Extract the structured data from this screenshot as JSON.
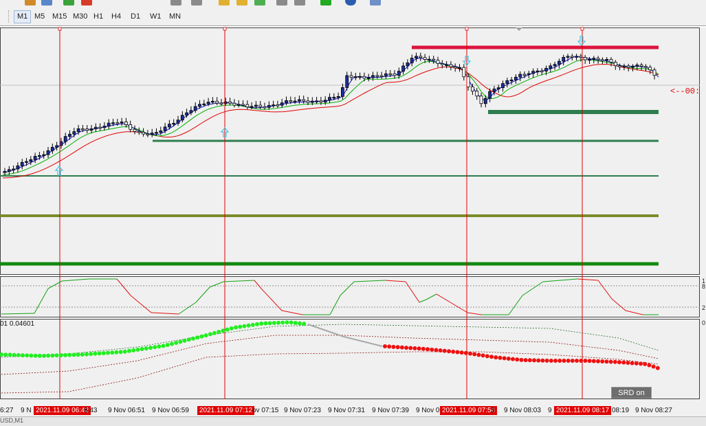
{
  "toolbar": {
    "timeframes": [
      {
        "label": "M1",
        "active": true
      },
      {
        "label": "M5",
        "active": false
      },
      {
        "label": "M15",
        "active": false
      },
      {
        "label": "M30",
        "active": false
      },
      {
        "label": "H1",
        "active": false
      },
      {
        "label": "H4",
        "active": false
      },
      {
        "label": "D1",
        "active": false
      },
      {
        "label": "W1",
        "active": false
      },
      {
        "label": "MN",
        "active": false
      }
    ]
  },
  "chart": {
    "price_marker": "<--00:",
    "right_scale_marks": [
      "1",
      "8",
      "2",
      "0"
    ],
    "osc2_label": "01 0.04601",
    "srd_button": "SRD on",
    "status_text": "USD,M1"
  },
  "time_axis": [
    {
      "text": "6:27",
      "highlight": false
    },
    {
      "text": "9 N",
      "highlight": false
    },
    {
      "text": "2021.11.09 06:42",
      "highlight": true
    },
    {
      "text": "6:43",
      "highlight": false
    },
    {
      "text": "9 Nov 06:51",
      "highlight": false
    },
    {
      "text": "9 Nov 06:59",
      "highlight": false
    },
    {
      "text": "2021.11.09 07:12",
      "highlight": true
    },
    {
      "text": "ov 07:15",
      "highlight": false
    },
    {
      "text": "9 Nov 07:23",
      "highlight": false
    },
    {
      "text": "9 Nov 07:31",
      "highlight": false
    },
    {
      "text": "9 Nov 07:39",
      "highlight": false
    },
    {
      "text": "9 Nov 0",
      "highlight": false
    },
    {
      "text": "2021.11.09 07:56",
      "highlight": true
    },
    {
      "text": "5",
      "highlight": false
    },
    {
      "text": "9 Nov 08:03",
      "highlight": false
    },
    {
      "text": "9",
      "highlight": false
    },
    {
      "text": "2021.11.09 08:17",
      "highlight": true
    },
    {
      "text": "08:19",
      "highlight": false
    },
    {
      "text": "9 Nov 08:27",
      "highlight": false
    }
  ],
  "colors": {
    "bull_candle": "#1c2f9c",
    "bear_candle": "#ffffff",
    "ma_fast": "#1010c0",
    "ma_mid": "#00b000",
    "ma_slow": "#e00000",
    "resistance": "#dc143c",
    "support_dark": "#2e7d4f",
    "support_olive": "#7a8c2a",
    "support_green": "#128a12",
    "dots_green": "#22ee22",
    "dots_red": "#ee1111"
  }
}
